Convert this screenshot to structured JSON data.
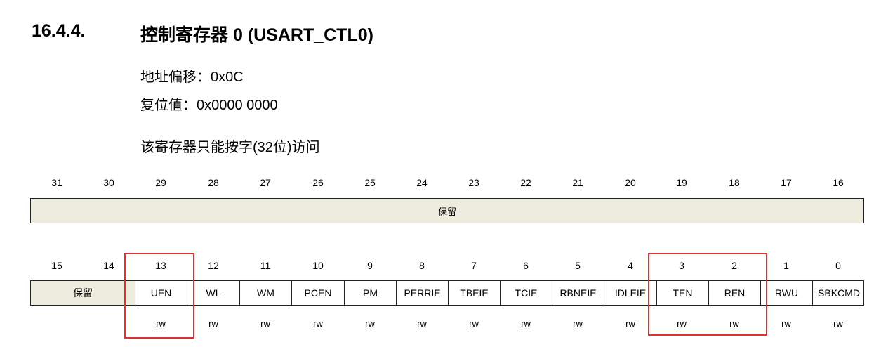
{
  "section": {
    "number": "16.4.4.",
    "title": "控制寄存器 0 (USART_CTL0)"
  },
  "info": {
    "offset": "地址偏移：0x0C",
    "reset": "复位值：0x0000 0000",
    "access_note": "该寄存器只能按字(32位)访问"
  },
  "upper": {
    "bit_numbers": [
      "31",
      "30",
      "29",
      "28",
      "27",
      "26",
      "25",
      "24",
      "23",
      "22",
      "21",
      "20",
      "19",
      "18",
      "17",
      "16"
    ],
    "reserved_label": "保留"
  },
  "lower": {
    "bit_numbers": [
      "15",
      "14",
      "13",
      "12",
      "11",
      "10",
      "9",
      "8",
      "7",
      "6",
      "5",
      "4",
      "3",
      "2",
      "1",
      "0"
    ],
    "fields": [
      {
        "label": "保留",
        "reserved": true
      },
      {
        "label": "UEN"
      },
      {
        "label": "WL"
      },
      {
        "label": "WM"
      },
      {
        "label": "PCEN"
      },
      {
        "label": "PM"
      },
      {
        "label": "PERRIE"
      },
      {
        "label": "TBEIE"
      },
      {
        "label": "TCIE"
      },
      {
        "label": "RBNEIE"
      },
      {
        "label": "IDLEIE"
      },
      {
        "label": "TEN"
      },
      {
        "label": "REN"
      },
      {
        "label": "RWU"
      },
      {
        "label": "SBKCMD"
      }
    ],
    "access": [
      "rw",
      "rw",
      "rw",
      "rw",
      "rw",
      "rw",
      "rw",
      "rw",
      "rw",
      "rw",
      "rw",
      "rw",
      "rw",
      "rw"
    ]
  },
  "colors": {
    "reserved_fill": "#eeebdf",
    "highlight": "#e03131"
  }
}
